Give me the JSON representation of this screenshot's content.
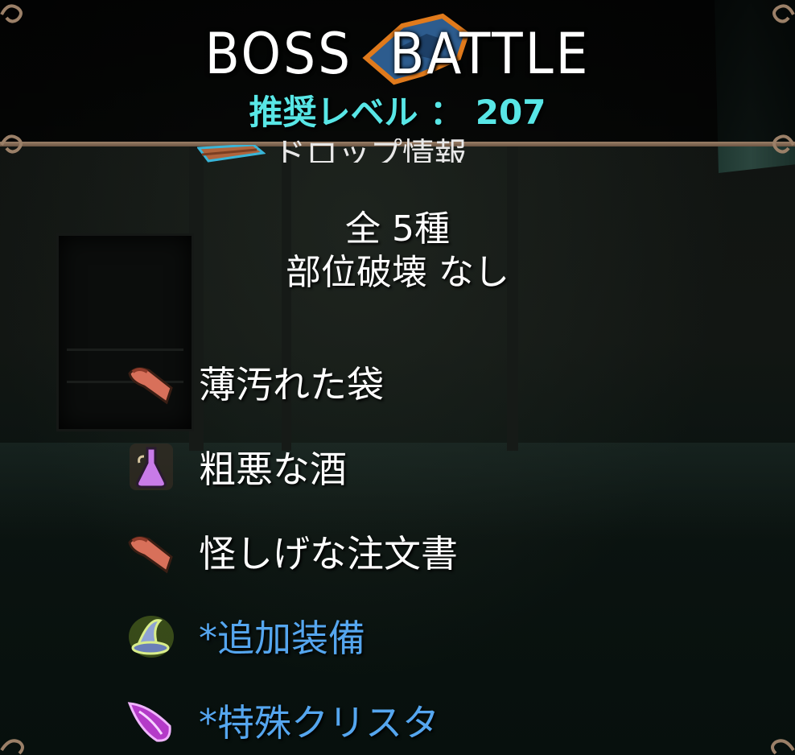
{
  "header": {
    "title": "BOSS  BATTLE",
    "recommended_level": "推奨レベル ： 207"
  },
  "intel": {
    "label": "ドロップ情報"
  },
  "summary": {
    "count": "全 5種",
    "part_break": "部位破壊 なし"
  },
  "drops": [
    {
      "icon": "cloth-bag-icon",
      "name": "薄汚れた袋",
      "special": false
    },
    {
      "icon": "potion-flask-icon",
      "name": "粗悪な酒",
      "special": false
    },
    {
      "icon": "scroll-document-icon",
      "name": "怪しげな注文書",
      "special": false
    },
    {
      "icon": "wizard-hat-icon",
      "name": "*追加装備",
      "special": true
    },
    {
      "icon": "crystal-shard-icon",
      "name": "*特殊クリスタ",
      "special": true
    }
  ],
  "colors": {
    "level_text": "#58e6e6",
    "special_text": "#55a6ef",
    "divider": "#9b8068"
  }
}
